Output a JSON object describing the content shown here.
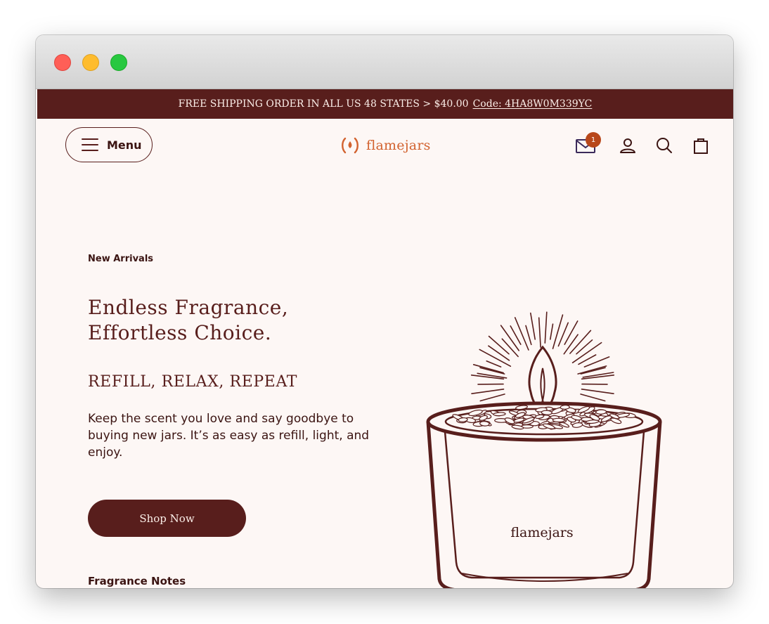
{
  "window": {
    "traffic_lights": [
      "close",
      "minimize",
      "maximize"
    ]
  },
  "announcement": {
    "text": "FREE SHIPPING ORDER IN ALL US 48 STATES > $40.00",
    "code": "Code: 4HA8W0M339YC"
  },
  "header": {
    "menu_label": "Menu",
    "logo_text": "flamejars",
    "inbox_badge": "1",
    "icons": [
      "mail-icon",
      "account-icon",
      "search-icon",
      "bag-icon"
    ]
  },
  "hero": {
    "eyebrow": "New Arrivals",
    "title_line1": "Endless Fragrance,",
    "title_line2": "Effortless Choice.",
    "subtitle": "REFILL, RELAX, REPEAT",
    "body": "Keep the scent you love and say goodbye to buying new jars. It’s as easy as refill, light, and enjoy.",
    "cta": "Shop Now",
    "notes_label": "Fragrance Notes",
    "jar_brand": "flamejars"
  },
  "colors": {
    "brand_dark": "#581e1c",
    "accent_orange": "#d2622f",
    "page_bg": "#fdf7f5",
    "badge": "#b8471a"
  }
}
